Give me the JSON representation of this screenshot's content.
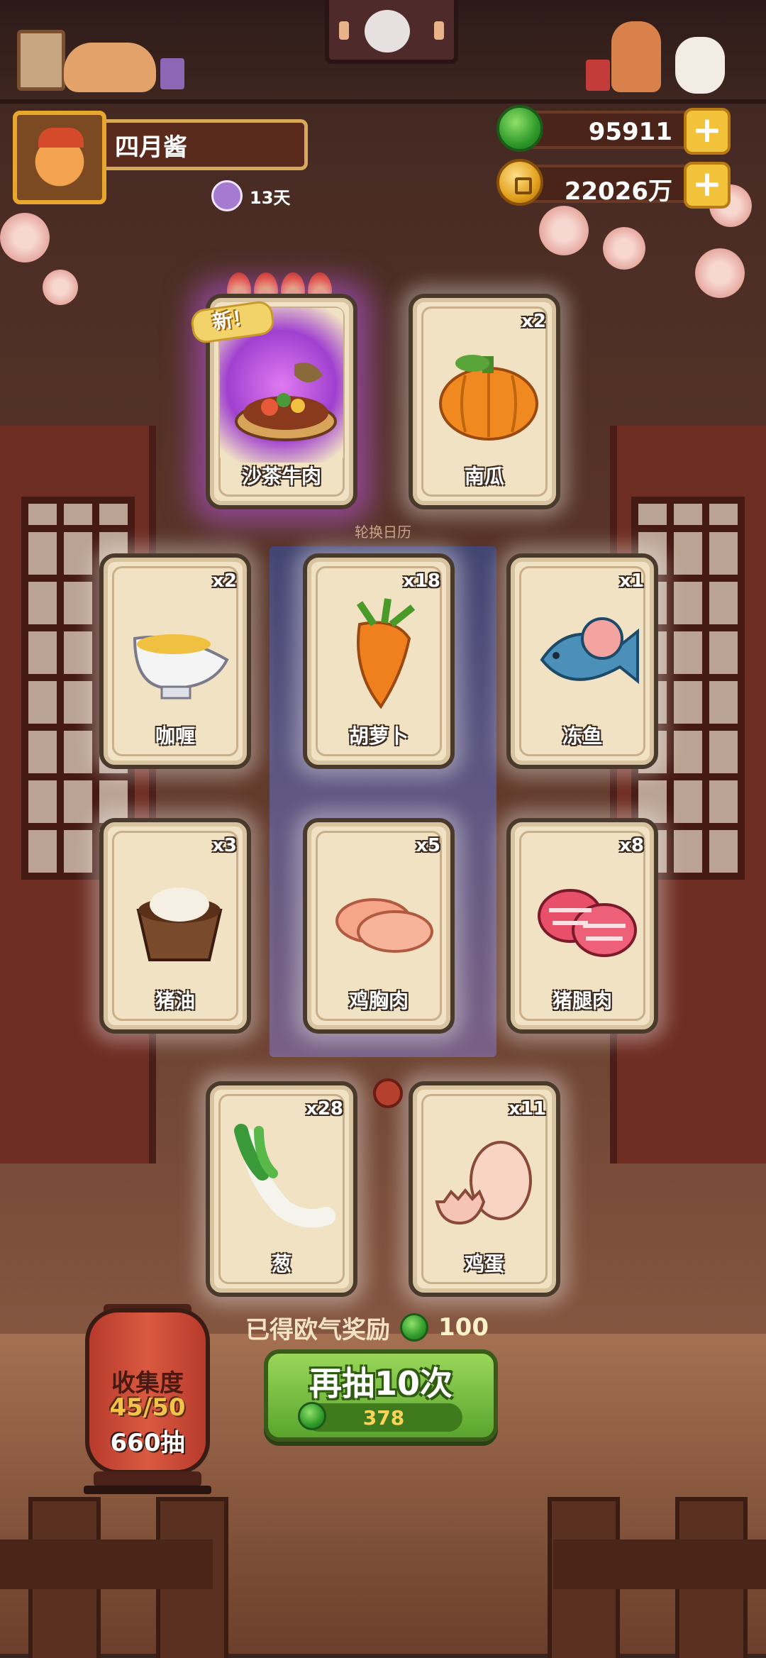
{
  "player": {
    "name": "四月酱",
    "days": "13天"
  },
  "currency": {
    "jade": "95911",
    "gold": "22026万"
  },
  "new_badge": "新！",
  "calendar_label": "轮换日历",
  "cards": [
    {
      "name": "沙茶牛肉",
      "count": "",
      "icon": "satay-beef-hotpot-icon",
      "rare": true
    },
    {
      "name": "南瓜",
      "count": "x2",
      "icon": "pumpkin-icon"
    },
    {
      "name": "咖喱",
      "count": "x2",
      "icon": "curry-sauce-boat-icon"
    },
    {
      "name": "胡萝卜",
      "count": "x18",
      "icon": "carrot-icon"
    },
    {
      "name": "冻鱼",
      "count": "x1",
      "icon": "frozen-fish-icon"
    },
    {
      "name": "猪油",
      "count": "x3",
      "icon": "lard-icon"
    },
    {
      "name": "鸡胸肉",
      "count": "x5",
      "icon": "chicken-breast-icon"
    },
    {
      "name": "猪腿肉",
      "count": "x8",
      "icon": "pork-leg-icon"
    },
    {
      "name": "葱",
      "count": "x28",
      "icon": "scallion-icon"
    },
    {
      "name": "鸡蛋",
      "count": "x11",
      "icon": "egg-icon"
    }
  ],
  "reward": {
    "label": "已得欧气奖励",
    "amount": "100"
  },
  "draw_button": {
    "label": "再抽10次",
    "cost": "378"
  },
  "collection": {
    "label": "收集度",
    "progress": "45/50",
    "draws": "660抽"
  }
}
